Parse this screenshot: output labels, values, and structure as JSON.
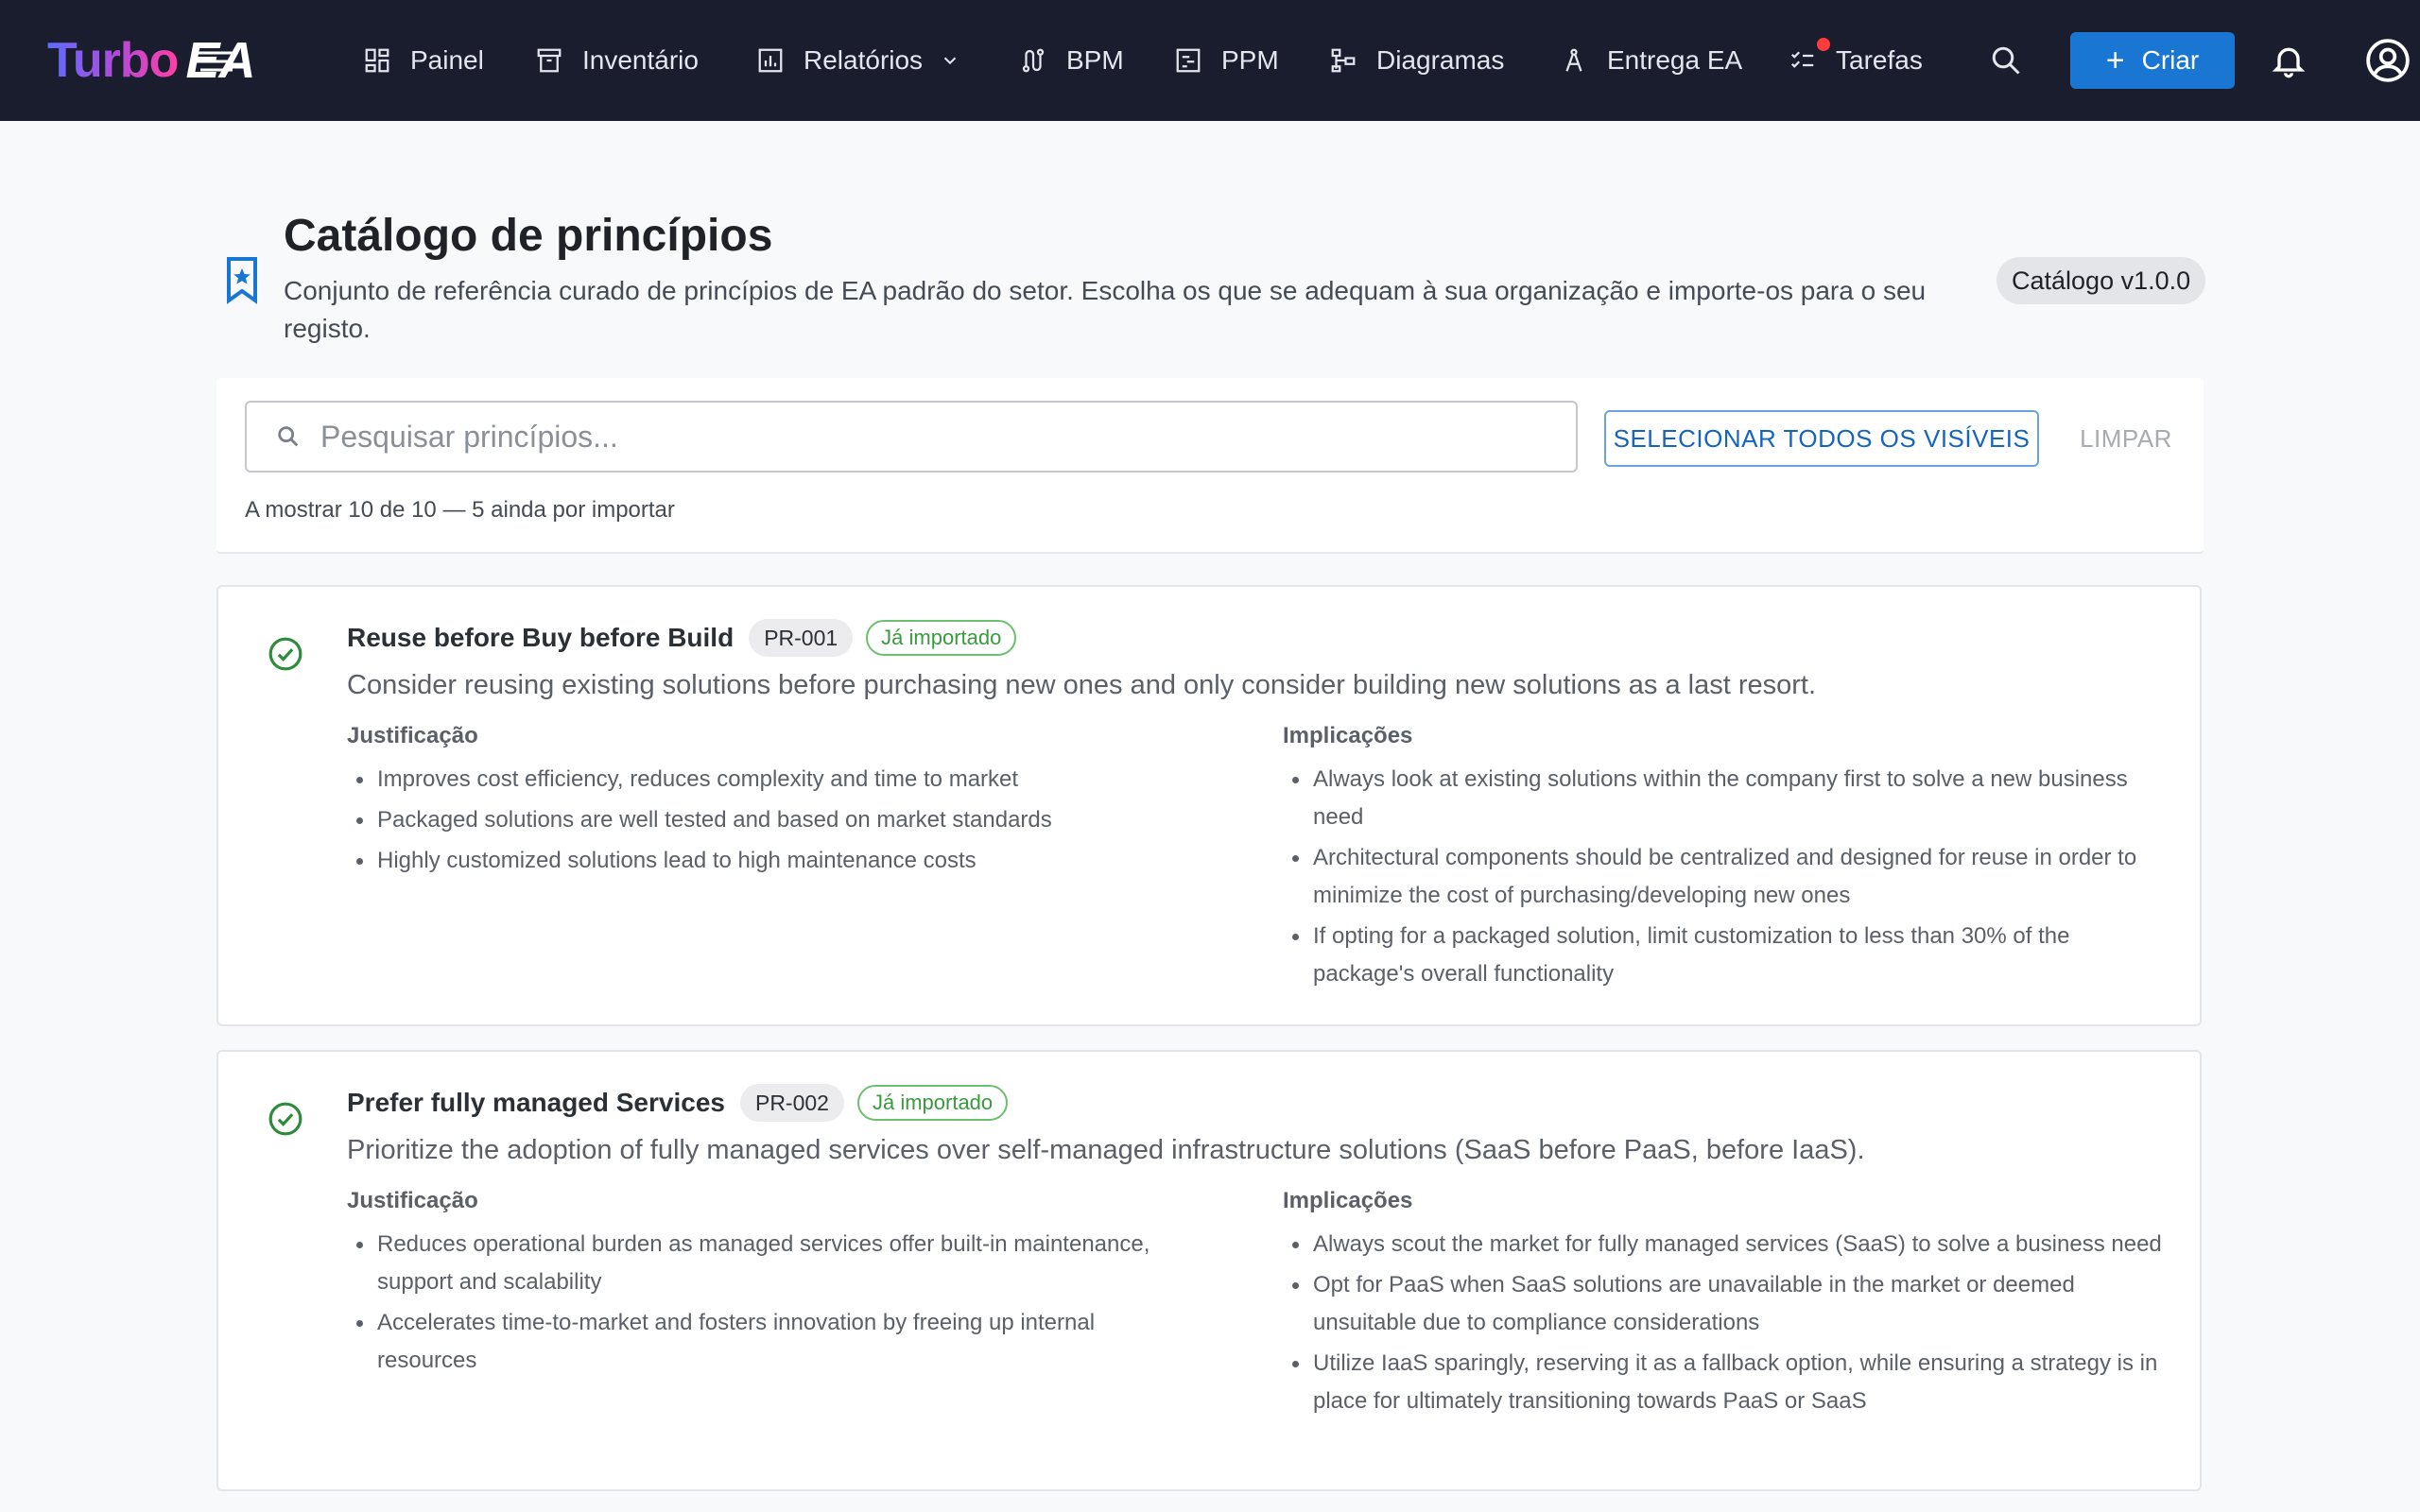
{
  "app": {
    "logo_turbo": "Turbo",
    "logo_ea": "EA"
  },
  "nav": {
    "items": [
      {
        "id": "painel",
        "label": "Painel",
        "icon": "dashboard-icon"
      },
      {
        "id": "inventario",
        "label": "Inventário",
        "icon": "archive-icon"
      },
      {
        "id": "relatorios",
        "label": "Relatórios",
        "icon": "bar-chart-icon",
        "has_dropdown": true
      },
      {
        "id": "bpm",
        "label": "BPM",
        "icon": "route-icon"
      },
      {
        "id": "ppm",
        "label": "PPM",
        "icon": "kanban-icon"
      },
      {
        "id": "diagramas",
        "label": "Diagramas",
        "icon": "diagram-icon"
      },
      {
        "id": "entrega",
        "label": "Entrega EA",
        "icon": "compass-icon"
      },
      {
        "id": "tarefas",
        "label": "Tarefas",
        "icon": "checklist-icon",
        "has_notification": true
      }
    ],
    "create_label": "Criar"
  },
  "page": {
    "title": "Catálogo de princípios",
    "subtitle": "Conjunto de referência curado de princípios de EA padrão do setor. Escolha os que se adequam à sua organização e importe-os para o seu registo.",
    "version": "Catálogo v1.0.0"
  },
  "search": {
    "placeholder": "Pesquisar princípios...",
    "value": "",
    "select_all_label": "SELECIONAR TODOS OS VISÍVEIS",
    "clear_label": "LIMPAR",
    "result_count": "A mostrar 10 de 10 — 5 ainda por importar"
  },
  "labels": {
    "justification": "Justificação",
    "implications": "Implicações"
  },
  "colors": {
    "nav_bg": "#1a1d2e",
    "accent": "#1976d2",
    "imported_green": "#3a9a3e"
  },
  "principles": [
    {
      "title": "Reuse before Buy before Build",
      "id": "PR-001",
      "status": "Já importado",
      "description": "Consider reusing existing solutions before purchasing new ones and only consider building new solutions as a last resort.",
      "justification": [
        "Improves cost efficiency, reduces complexity and time to market",
        "Packaged solutions are well tested and based on market standards",
        "Highly customized solutions lead to high maintenance costs"
      ],
      "implications": [
        "Always look at existing solutions within the company first to solve a new business need",
        "Architectural components should be centralized and designed for reuse in order to minimize the cost of purchasing/developing new ones",
        "If opting for a packaged solution, limit customization to less than 30% of the package's overall functionality"
      ]
    },
    {
      "title": "Prefer fully managed Services",
      "id": "PR-002",
      "status": "Já importado",
      "description": "Prioritize the adoption of fully managed services over self-managed infrastructure solutions (SaaS before PaaS, before IaaS).",
      "justification": [
        "Reduces operational burden as managed services offer built-in maintenance, support and scalability",
        "Accelerates time-to-market and fosters innovation by freeing up internal resources"
      ],
      "implications": [
        "Always scout the market for fully managed services (SaaS) to solve a business need",
        "Opt for PaaS when SaaS solutions are unavailable in the market or deemed unsuitable due to compliance considerations",
        "Utilize IaaS sparingly, reserving it as a fallback option, while ensuring a strategy is in place for ultimately transitioning towards PaaS or SaaS"
      ]
    }
  ]
}
